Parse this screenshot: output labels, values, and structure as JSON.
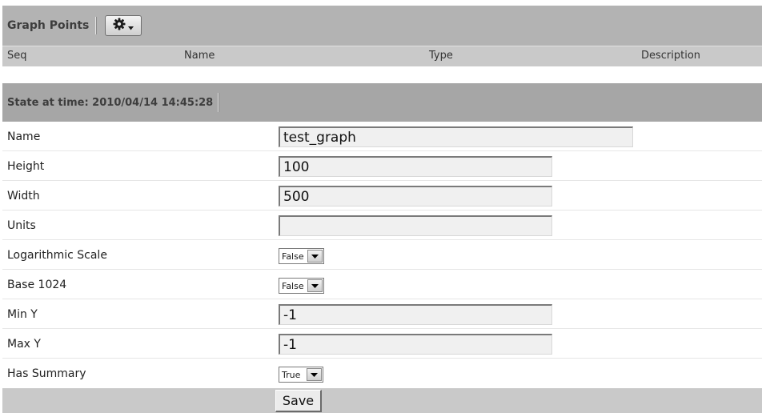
{
  "graph_points": {
    "title": "Graph Points",
    "gear_icon": "gear-icon",
    "columns": [
      "Seq",
      "Name",
      "Type",
      "Description"
    ]
  },
  "state": {
    "title": "State at time: 2010/04/14 14:45:28"
  },
  "form": {
    "name": {
      "label": "Name",
      "value": "test_graph"
    },
    "height": {
      "label": "Height",
      "value": "100"
    },
    "width": {
      "label": "Width",
      "value": "500"
    },
    "units": {
      "label": "Units",
      "value": ""
    },
    "log_scale": {
      "label": "Logarithmic Scale",
      "value": "False"
    },
    "base1024": {
      "label": "Base 1024",
      "value": "False"
    },
    "miny": {
      "label": "Min Y",
      "value": "-1"
    },
    "maxy": {
      "label": "Max Y",
      "value": "-1"
    },
    "has_summary": {
      "label": "Has Summary",
      "value": "True"
    }
  },
  "save_label": "Save"
}
